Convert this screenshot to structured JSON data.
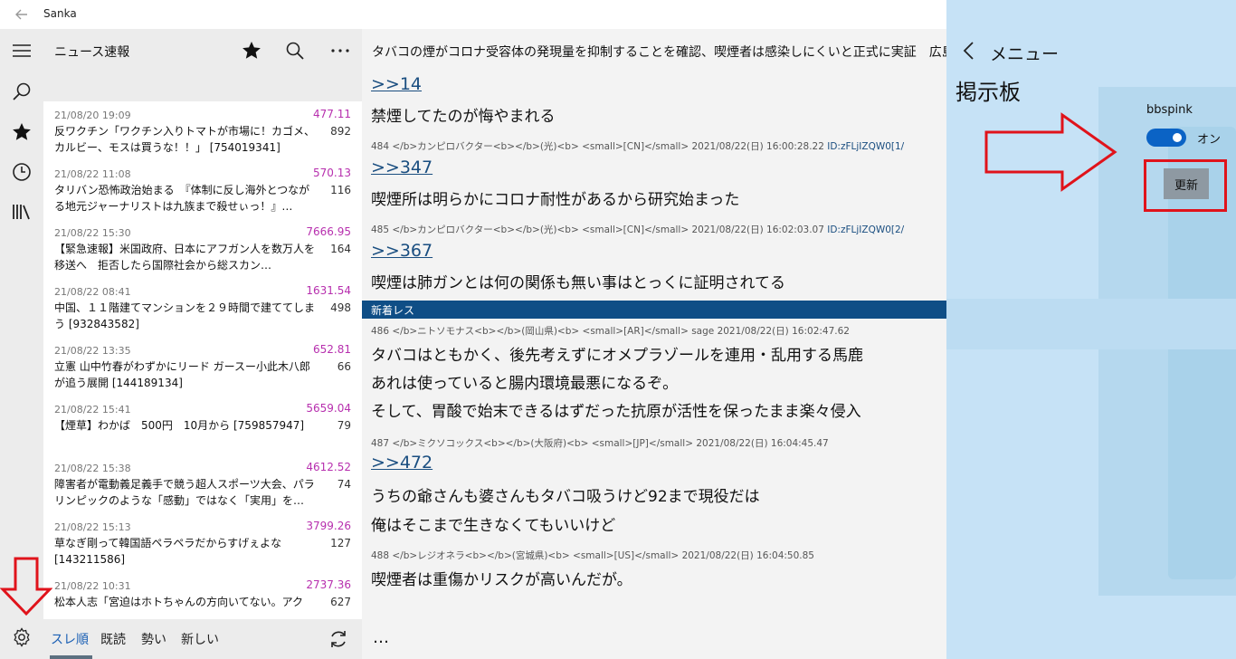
{
  "app": {
    "title": "Sanka"
  },
  "window": {
    "back_icon": "back-arrow-icon",
    "minimize_icon": "minimize-icon",
    "restore_icon": "restore-icon",
    "close_icon": "close-icon"
  },
  "rail": {
    "items": [
      "hamburger-icon",
      "search-icon",
      "star-icon",
      "clock-icon",
      "library-icon"
    ],
    "settings_icon": "gear-icon"
  },
  "list": {
    "board_name": "ニュース速報",
    "threads": [
      {
        "date": "21/08/20 19:09",
        "speed": "477.11",
        "count": "892",
        "title": "反ワクチン「ワクチン入りトマトが市場に！カゴメ、カルビー、モスは買うな！！」 [754019341]"
      },
      {
        "date": "21/08/22 11:08",
        "speed": "570.13",
        "count": "116",
        "title": "タリバン恐怖政治始まる　『体制に反し海外とつながる地元ジャーナリストは九族まで殺せぃっ！』…"
      },
      {
        "date": "21/08/22 15:30",
        "speed": "7666.95",
        "count": "164",
        "title": "【緊急速報】米国政府、日本にアフガン人を数万人を移送へ　拒否したら国際社会から総スカン…"
      },
      {
        "date": "21/08/22 08:41",
        "speed": "1631.54",
        "count": "498",
        "title": "中国、１１階建てマンションを２９時間で建ててしまう [932843582]"
      },
      {
        "date": "21/08/22 13:35",
        "speed": "652.81",
        "count": "66",
        "title": "立憲 山中竹春がわずかにリード ガースー小此木八郎が追う展開 [144189134]"
      },
      {
        "date": "21/08/22 15:41",
        "speed": "5659.04",
        "count": "79",
        "title": "【煙草】わかば　500円　10月から [759857947]"
      },
      {
        "date": "21/08/22 15:38",
        "speed": "4612.52",
        "count": "74",
        "title": "障害者が電動義足義手で競う超人スポーツ大会、パラリンピックのような「感動」ではなく「実用」を…"
      },
      {
        "date": "21/08/22 15:13",
        "speed": "3799.26",
        "count": "127",
        "title": "草なぎ剛って韓国語ペラペラだからすげぇよな [143211586]"
      },
      {
        "date": "21/08/22 10:31",
        "speed": "2737.36",
        "count": "627",
        "title": "松本人志「宮迫はホトちゃんの方向いてない。アク"
      }
    ],
    "tabs": [
      "スレ順",
      "既読",
      "勢い",
      "新しい"
    ]
  },
  "thread": {
    "title": "タバコの煙がコロナ受容体の発現量を抑制することを確認、喫煙者は感染しにくいと正式に実証　広島大学",
    "posts": [
      {
        "anchor": ">>14",
        "lines": [
          "禁煙してたのが悔やまれる"
        ]
      },
      {
        "meta": "484 </b>カンピロバクター<b></b>(光)<b> <small>[CN]</small>   2021/08/22(日) 16:00:28.22",
        "uid": "ID:zFLjIZQW0[1/",
        "anchor": ">>347",
        "lines": [
          "喫煙所は明らかにコロナ耐性があるから研究始まった"
        ]
      },
      {
        "meta": "485 </b>カンピロバクター<b></b>(光)<b> <small>[CN]</small>   2021/08/22(日) 16:02:03.07",
        "uid": "ID:zFLjIZQW0[2/",
        "anchor": ">>367",
        "lines": [
          "喫煙は肺ガンとは何の関係も無い事はとっくに証明されてる"
        ]
      },
      {
        "meta": "486 </b>ニトソモナス<b></b>(岡山県)<b> <small>[AR]</small>  sage 2021/08/22(日) 16:02:47.62",
        "lines": [
          "タバコはともかく、後先考えずにオメプラゾールを連用・乱用する馬鹿",
          "あれは使っていると腸内環境最悪になるぞ。",
          "そして、胃酸で始末できるはずだった抗原が活性を保ったまま楽々侵入"
        ]
      },
      {
        "meta": "487 </b>ミクソコックス<b></b>(大阪府)<b> <small>[JP]</small>    2021/08/22(日) 16:04:45.47",
        "anchor": ">>472",
        "lines": [
          "うちの爺さんも婆さんもタバコ吸うけど92まで現役だは",
          "俺はそこまで生きなくてもいいけど"
        ]
      },
      {
        "meta": "488 </b>レジオネラ<b></b>(宮城県)<b> <small>[US]</small>    2021/08/22(日) 16:04:50.85",
        "lines": [
          "喫煙者は重傷かリスクが高いんだが。"
        ]
      }
    ],
    "new_label": "新着レス",
    "more": "…"
  },
  "menu": {
    "title": "メニュー",
    "section": "掲示板",
    "toggle_label": "bbspink",
    "toggle_state": "オン",
    "refresh": "更新"
  },
  "colors": {
    "accent": "#0b63c5",
    "speed": "#b72fae",
    "new_bar": "#0f4e86",
    "annotation": "#e0131b"
  }
}
